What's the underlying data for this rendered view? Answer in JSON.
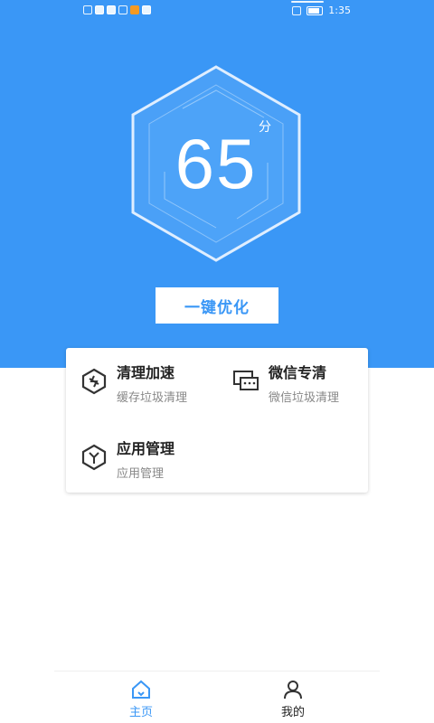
{
  "status_bar": {
    "time": "1:35"
  },
  "score": {
    "value": "65",
    "unit": "分"
  },
  "optimize_button": {
    "label": "一键优化"
  },
  "features": [
    {
      "title": "清理加速",
      "subtitle": "缓存垃圾清理",
      "icon": "clean-boost-icon"
    },
    {
      "title": "微信专清",
      "subtitle": "微信垃圾清理",
      "icon": "wechat-chat-icon"
    },
    {
      "title": "应用管理",
      "subtitle": "应用管理",
      "icon": "app-manage-icon"
    }
  ],
  "tabs": [
    {
      "label": "主页",
      "icon": "home-icon",
      "active": true
    },
    {
      "label": "我的",
      "icon": "user-icon",
      "active": false
    }
  ],
  "colors": {
    "primary": "#3a97f6",
    "title_text": "#222222",
    "sub_text": "#888888"
  }
}
